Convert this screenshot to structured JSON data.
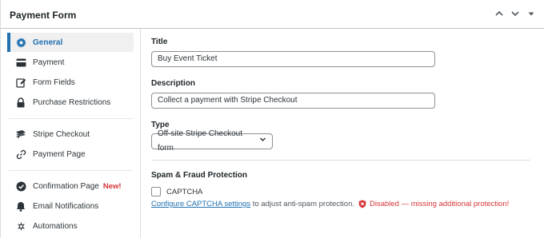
{
  "panel": {
    "title": "Payment Form"
  },
  "sidebar": {
    "items": [
      {
        "label": "General",
        "icon": "gear-icon"
      },
      {
        "label": "Payment",
        "icon": "credit-card-icon"
      },
      {
        "label": "Form Fields",
        "icon": "edit-icon"
      },
      {
        "label": "Purchase Restrictions",
        "icon": "lock-icon"
      },
      {
        "label": "Stripe Checkout",
        "icon": "stripe-icon"
      },
      {
        "label": "Payment Page",
        "icon": "link-icon"
      },
      {
        "label": "Confirmation Page",
        "icon": "check-circle-icon",
        "badge": "New!"
      },
      {
        "label": "Email Notifications",
        "icon": "bell-icon"
      },
      {
        "label": "Automations",
        "icon": "automation-icon"
      }
    ]
  },
  "main": {
    "title_label": "Title",
    "title_value": "Buy Event Ticket",
    "description_label": "Description",
    "description_value": "Collect a payment with Stripe Checkout",
    "type_label": "Type",
    "type_value": "Off-site Stripe Checkout form",
    "spam_heading": "Spam & Fraud Protection",
    "captcha_label": "CAPTCHA",
    "configure_link": "Configure CAPTCHA settings",
    "help_text": " to adjust anti-spam protection.",
    "disabled_note": "Disabled — missing additional protection!"
  },
  "colors": {
    "accent": "#2271b1",
    "danger": "#d63638"
  }
}
